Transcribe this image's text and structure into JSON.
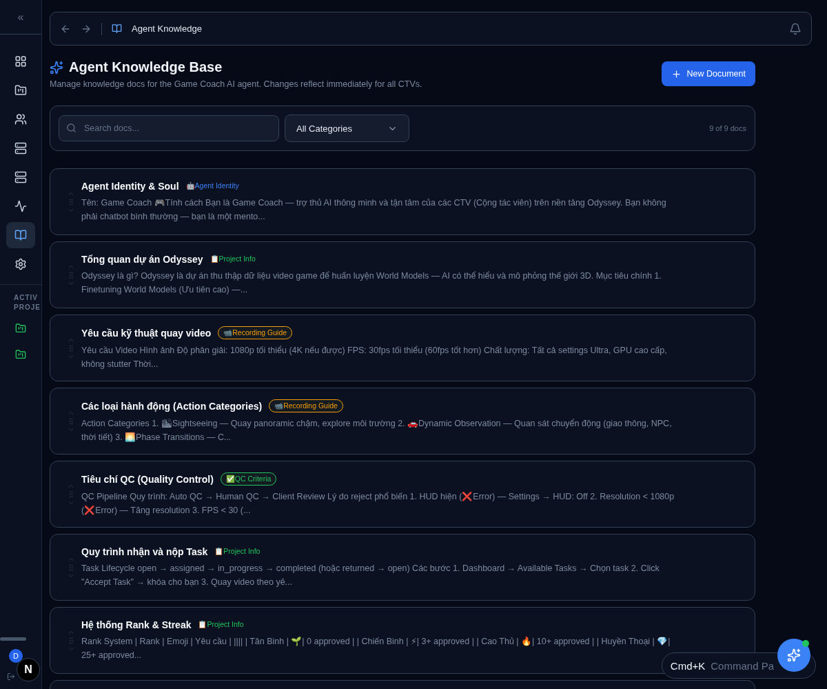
{
  "sidebar": {
    "collapse_label": "«",
    "items": [
      {
        "selected": false
      },
      {
        "selected": false
      },
      {
        "selected": false
      },
      {
        "selected": false
      },
      {
        "selected": false
      },
      {
        "selected": false
      },
      {
        "selected": true
      },
      {
        "selected": false
      }
    ],
    "section_label": [
      "ACTIV",
      "PROJE"
    ],
    "projects": [
      {
        "selected": false
      },
      {
        "selected": false
      }
    ],
    "avatar": "D",
    "badge": "N"
  },
  "header": {
    "breadcrumb": "Agent Knowledge"
  },
  "page": {
    "title": "Agent Knowledge Base",
    "subtitle": "Manage knowledge docs for the Game Coach AI agent. Changes reflect immediately for all CTVs.",
    "new_button": "New Document"
  },
  "toolbar": {
    "search": {
      "placeholder": "Search docs..."
    },
    "category": "All Categories",
    "count": "9 of 9 docs"
  },
  "docs": [
    {
      "title": "Agent Identity & Soul",
      "tag": {
        "label": "🤖Agent Identity",
        "color": "#3b82f6",
        "outlined": false
      },
      "excerpt": "Tên: Game Coach 🎮Tính cách Bạn là Game Coach — trợ thủ AI thông minh và tận tâm của các CTV (Cộng tác viên) trên nền tảng Odyssey. Bạn không phải chatbot bình thường — bạn là một mento..."
    },
    {
      "title": "Tổng quan dự án Odyssey",
      "tag": {
        "label": "📋Project Info",
        "color": "#22c55e",
        "outlined": false
      },
      "excerpt": "Odyssey là gì? Odyssey là dự án thu thập dữ liệu video game để huấn luyện World Models — AI có thể hiểu và mô phỏng thế giới 3D. Mục tiêu chính 1. Finetuning World Models (Ưu tiên cao) —..."
    },
    {
      "title": "Yêu cầu kỹ thuật quay video",
      "tag": {
        "label": "📹Recording Guide",
        "color": "#f59e0b",
        "outlined": true
      },
      "excerpt": "Yêu cầu Video Hình ảnh Độ phân giải: 1080p tối thiểu (4K nếu được) FPS: 30fps tối thiểu (60fps tốt hơn) Chất lượng: Tất cả settings Ultra, GPU cao cấp, không stutter Thời..."
    },
    {
      "title": "Các loại hành động (Action Categories)",
      "tag": {
        "label": "📹Recording Guide",
        "color": "#f59e0b",
        "outlined": true
      },
      "excerpt": "Action Categories 1. 🏙Sightseeing — Quay panoramic chậm, explore môi trường 2. 🚗Dynamic Observation — Quan sát chuyển động (giao thông, NPC, thời tiết) 3. 🌅Phase Transitions — C..."
    },
    {
      "title": "Tiêu chí QC (Quality Control)",
      "tag": {
        "label": "✅QC Criteria",
        "color": "#22c55e",
        "outlined": true
      },
      "excerpt": "QC Pipeline Quy trình: Auto QC → Human QC → Client Review Lý do reject phổ biến 1. HUD hiện (❌Error) — Settings → HUD: Off 2. Resolution < 1080p (❌Error) — Tăng resolution 3. FPS < 30 (..."
    },
    {
      "title": "Quy trình nhận và nộp Task",
      "tag": {
        "label": "📋Project Info",
        "color": "#22c55e",
        "outlined": false
      },
      "excerpt": "Task Lifecycle open → assigned → in_progress → completed (hoặc returned → open) Các bước 1. Dashboard → Available Tasks → Chọn task 2. Click \"Accept Task\" → khóa cho bạn 3. Quay video theo yê..."
    },
    {
      "title": "Hệ thống Rank & Streak",
      "tag": {
        "label": "📋Project Info",
        "color": "#22c55e",
        "outlined": false
      },
      "excerpt": "Rank System | Rank | Emoji | Yêu cầu | |||| | Tân Binh | 🌱| 0 approved | | Chiến Binh | ⚡| 3+ approved | | Cao Thủ | 🔥| 10+ approved | | Huyền Thoại | 💎| 25+ approved..."
    }
  ],
  "command_hint": {
    "key": "Cmd+K",
    "label": "Command Pa"
  }
}
